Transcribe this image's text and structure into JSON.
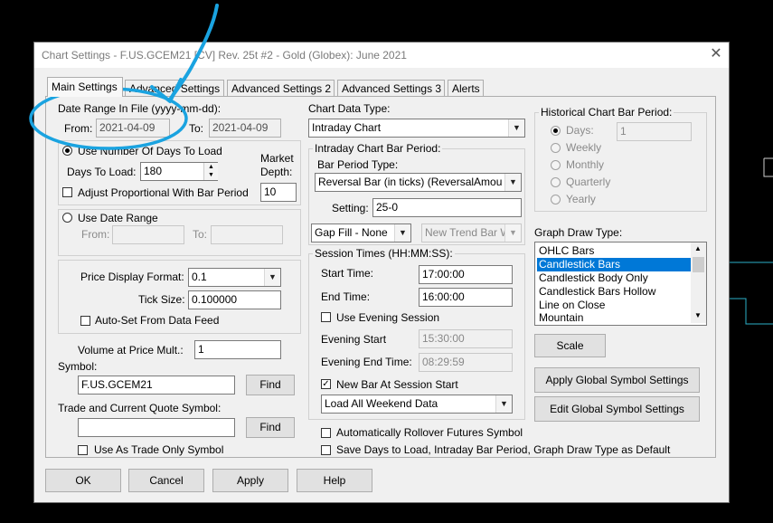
{
  "window": {
    "title": "Chart Settings - F.US.GCEM21 [CV]  Rev. 25t  #2 - Gold (Globex): June 2021",
    "close": "✕"
  },
  "tabs": [
    "Main Settings",
    "Advanced Settings",
    "Advanced Settings 2",
    "Advanced Settings 3",
    "Alerts"
  ],
  "date_range": {
    "label": "Date Range In File (yyyy-mm-dd):",
    "from_label": "From:",
    "from_value": "2021-04-09",
    "to_label": "To:",
    "to_value": "2021-04-09"
  },
  "days_load": {
    "radio_label": "Use Number Of Days To Load",
    "days_label": "Days To Load:",
    "days_value": "180",
    "market_depth_label_1": "Market",
    "market_depth_label_2": "Depth:",
    "market_depth_value": "10",
    "adjust_label": "Adjust Proportional With Bar Period"
  },
  "date_range_group": {
    "radio_label": "Use Date Range",
    "from_label": "From:",
    "to_label": "To:"
  },
  "price": {
    "format_label": "Price Display Format:",
    "format_value": "0.1",
    "tick_label": "Tick Size:",
    "tick_value": "0.100000",
    "autoset_label": "Auto-Set From Data Feed"
  },
  "volume": {
    "label": "Volume at Price Mult.:",
    "value": "1"
  },
  "symbol": {
    "label": "Symbol:",
    "value": "F.US.GCEM21",
    "find": "Find"
  },
  "trade_symbol": {
    "label": "Trade and Current Quote Symbol:",
    "value": "",
    "find": "Find",
    "trade_only_label": "Use As Trade Only Symbol"
  },
  "chart_data_type": {
    "label": "Chart Data Type:",
    "value": "Intraday Chart"
  },
  "intraday_period": {
    "group_label": "Intraday Chart Bar Period:",
    "type_label": "Bar Period Type:",
    "type_value": "Reversal Bar (in ticks) (ReversalAmou",
    "setting_label": "Setting:",
    "setting_value": "25-0",
    "gap_fill_value": "Gap Fill - None",
    "new_trend_value": "New Trend Bar W"
  },
  "session": {
    "group_label": "Session Times (HH:MM:SS):",
    "start_label": "Start Time:",
    "start_value": "17:00:00",
    "end_label": "End Time:",
    "end_value": "16:00:00",
    "evening_label": "Use Evening Session",
    "evening_start_label": "Evening Start",
    "evening_start_value": "15:30:00",
    "evening_end_label": "Evening End Time:",
    "evening_end_value": "08:29:59",
    "new_bar_label": "New Bar At Session Start",
    "weekend_value": "Load All Weekend Data"
  },
  "rollover_label": "Automatically Rollover Futures Symbol",
  "save_default_label": "Save Days to Load, Intraday Bar Period, Graph Draw Type as Default",
  "historical": {
    "group_label": "Historical Chart Bar Period:",
    "days": "Days:",
    "days_value": "1",
    "weekly": "Weekly",
    "monthly": "Monthly",
    "quarterly": "Quarterly",
    "yearly": "Yearly"
  },
  "graph_draw": {
    "label": "Graph Draw Type:",
    "items": [
      "OHLC Bars",
      "Candlestick Bars",
      "Candlestick Body Only",
      "Candlestick Bars Hollow",
      "Line on Close",
      "Mountain"
    ],
    "selected": "Candlestick Bars"
  },
  "buttons": {
    "scale": "Scale",
    "apply_global": "Apply Global Symbol Settings",
    "edit_global": "Edit Global Symbol Settings",
    "ok": "OK",
    "cancel": "Cancel",
    "apply": "Apply",
    "help": "Help"
  },
  "colors": {
    "annotation": "#1aa3e0",
    "selection": "#0078d7"
  }
}
